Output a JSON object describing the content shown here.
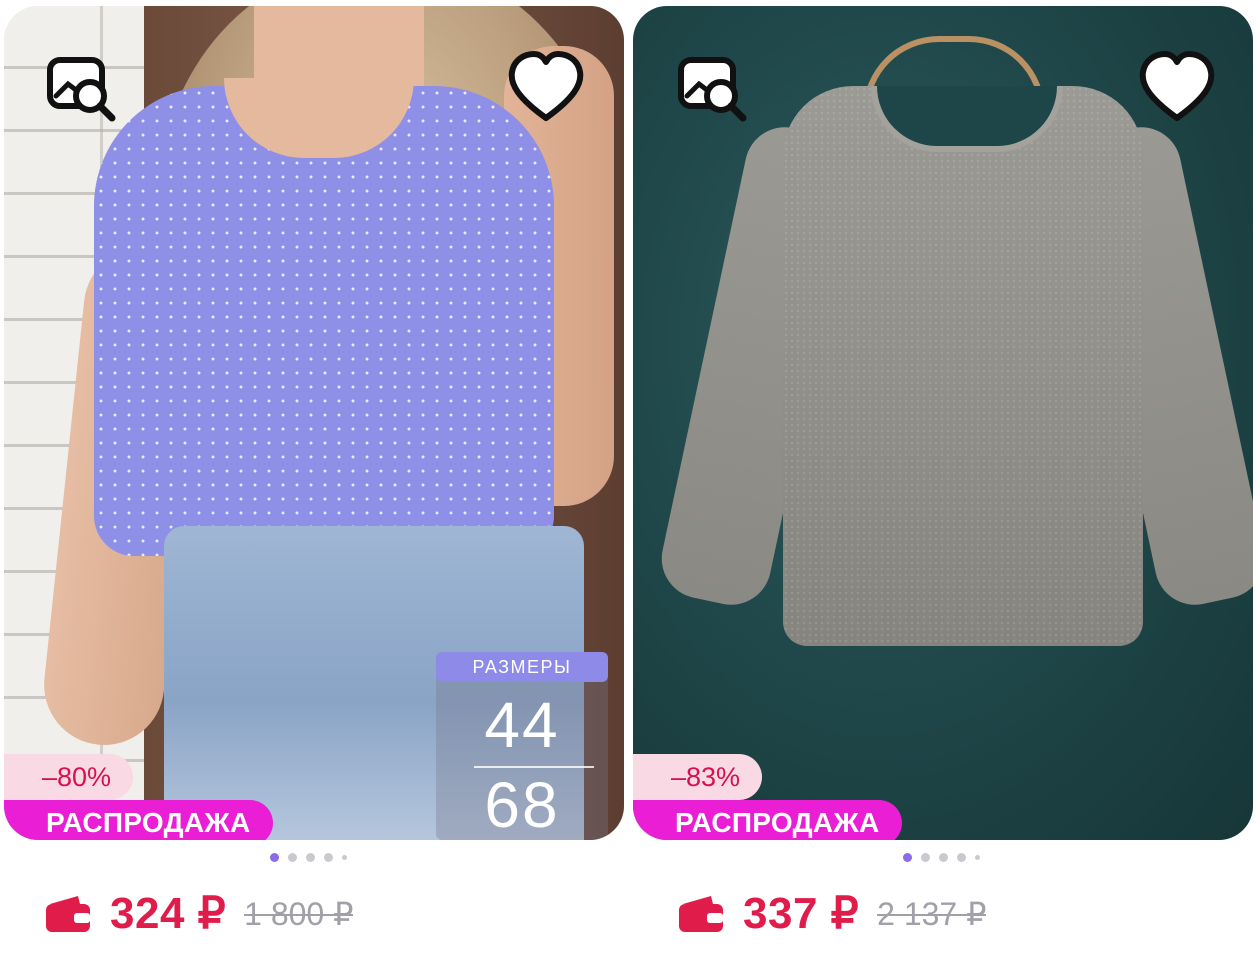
{
  "products": [
    {
      "discount": "–80%",
      "badge": "РАСПРОДАЖА",
      "sizes_label": "РАЗМЕРЫ",
      "size_min": "44",
      "size_max": "68",
      "price": "324 ₽",
      "old_price": "1 800 ₽",
      "images_total": 5,
      "image_index": 1
    },
    {
      "discount": "–83%",
      "badge": "РАСПРОДАЖА",
      "price": "337 ₽",
      "old_price": "2 137 ₽",
      "images_total": 5,
      "image_index": 1
    }
  ],
  "icons": {
    "similar_search": "image-search-icon",
    "favorite": "heart-icon",
    "payment": "wallet-icon"
  },
  "colors": {
    "price": "#e01c4b",
    "sale_badge": "#ea1fd5",
    "discount_bg": "#f8d9e4",
    "active_dot": "#8b6be8"
  }
}
